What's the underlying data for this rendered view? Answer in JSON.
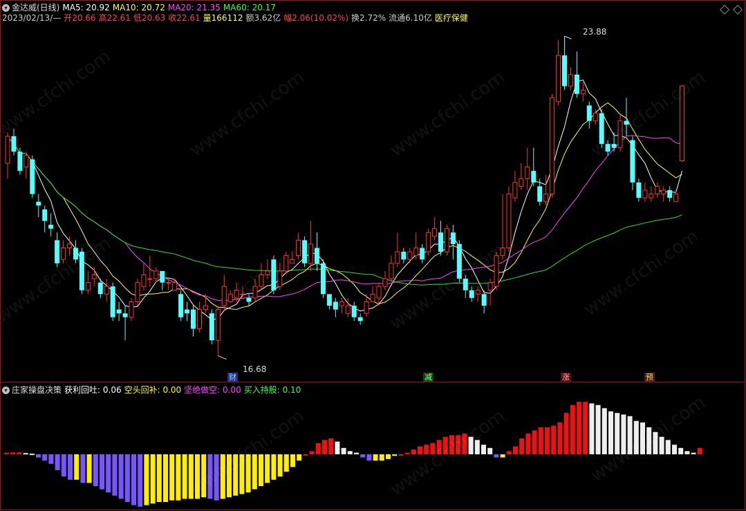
{
  "header": {
    "name": "金达威(日线)",
    "ma": [
      {
        "label": "MA5: 20.92",
        "color": "#ffffff"
      },
      {
        "label": "MA10: 20.72",
        "color": "#ffff55"
      },
      {
        "label": "MA20: 21.35",
        "color": "#ff44ff"
      },
      {
        "label": "MA60: 20.17",
        "color": "#44ff44"
      }
    ],
    "info": [
      {
        "label": "2023/02/13/—",
        "color": "#cccccc"
      },
      {
        "label": "开20.66",
        "color": "#ff4444"
      },
      {
        "label": "高22.61",
        "color": "#ff4444"
      },
      {
        "label": "低20.63",
        "color": "#ff4444"
      },
      {
        "label": "收22.61",
        "color": "#ff4444"
      },
      {
        "label": "量166112",
        "color": "#ffff55"
      },
      {
        "label": "额3.62亿",
        "color": "#cccccc"
      },
      {
        "label": "幅2.06(10.02%)",
        "color": "#ff4444"
      },
      {
        "label": "换2.72%",
        "color": "#cccccc"
      },
      {
        "label": "流通6.10亿",
        "color": "#cccccc"
      },
      {
        "label": "医疗保健",
        "color": "#ffff55"
      }
    ]
  },
  "price_chart": {
    "high_label": "23.88",
    "low_label": "16.68",
    "markers": [
      {
        "text": "财",
        "bg": "#333399",
        "color": "#88ccff"
      },
      {
        "text": "减",
        "bg": "#114411",
        "color": "#88ff88"
      },
      {
        "text": "涨",
        "bg": "#661111",
        "color": "#ffaaaa"
      },
      {
        "text": "预",
        "bg": "#553311",
        "color": "#ffcc88"
      }
    ],
    "watermark": "www.cfchi.com"
  },
  "indicator": {
    "name": "庄家操盘决策",
    "items": [
      {
        "label": "获利回吐: 0.06",
        "color": "#ffffff"
      },
      {
        "label": "空头回补: 0.00",
        "color": "#ffff00"
      },
      {
        "label": "坚绝做空: 0.00",
        "color": "#ff44ff"
      },
      {
        "label": "买入持股: 0.10",
        "color": "#44ff44"
      }
    ]
  },
  "chart_data": [
    {
      "type": "candlestick",
      "title": "金达威(日线)",
      "candles": [
        [
          20.6,
          21.3,
          21.4,
          20.2
        ],
        [
          21.3,
          20.9,
          21.5,
          20.8
        ],
        [
          20.9,
          20.4,
          21.0,
          20.3
        ],
        [
          20.5,
          20.8,
          20.9,
          20.2
        ],
        [
          20.7,
          19.8,
          20.8,
          19.7
        ],
        [
          19.6,
          19.5,
          19.8,
          19.2
        ],
        [
          19.4,
          19.1,
          19.5,
          18.8
        ],
        [
          19.0,
          18.9,
          19.3,
          18.7
        ],
        [
          18.6,
          18.0,
          18.8,
          17.9
        ],
        [
          18.1,
          18.4,
          18.6,
          18.0
        ],
        [
          18.4,
          18.5,
          18.7,
          18.2
        ],
        [
          18.4,
          18.1,
          18.6,
          18.0
        ],
        [
          18.3,
          17.3,
          18.4,
          17.2
        ],
        [
          17.3,
          17.5,
          17.8,
          17.2
        ],
        [
          17.6,
          17.7,
          17.9,
          17.4
        ],
        [
          17.5,
          17.2,
          17.6,
          17.1
        ],
        [
          17.2,
          17.4,
          17.6,
          17.0
        ],
        [
          17.4,
          16.6,
          17.5,
          16.5
        ],
        [
          16.8,
          16.7,
          17.0,
          16.5
        ],
        [
          16.7,
          16.6,
          16.9,
          16.0
        ],
        [
          16.6,
          17.0,
          17.1,
          16.5
        ],
        [
          17.0,
          17.5,
          17.6,
          16.9
        ],
        [
          17.4,
          17.7,
          18.0,
          17.3
        ],
        [
          17.6,
          17.6,
          18.2,
          17.4
        ],
        [
          17.6,
          17.8,
          17.9,
          17.5
        ],
        [
          17.8,
          17.5,
          17.8,
          17.3
        ],
        [
          17.5,
          17.5,
          17.6,
          17.3
        ],
        [
          17.3,
          17.5,
          17.6,
          17.3
        ],
        [
          17.2,
          16.6,
          17.3,
          16.5
        ],
        [
          16.8,
          16.7,
          17.0,
          16.5
        ],
        [
          16.8,
          16.3,
          16.9,
          16.1
        ],
        [
          16.3,
          16.8,
          17.0,
          16.2
        ],
        [
          16.8,
          16.9,
          17.2,
          16.7
        ],
        [
          16.7,
          16.0,
          16.8,
          15.9
        ],
        [
          16.0,
          16.8,
          16.9,
          15.6
        ],
        [
          16.9,
          17.4,
          17.7,
          16.8
        ],
        [
          17.0,
          17.2,
          17.3,
          17.0
        ],
        [
          17.1,
          17.3,
          17.5,
          17.0
        ],
        [
          17.2,
          17.2,
          17.4,
          17.1
        ],
        [
          17.1,
          17.0,
          17.2,
          16.9
        ],
        [
          17.1,
          17.4,
          17.6,
          17.0
        ],
        [
          17.4,
          17.7,
          18.0,
          17.3
        ],
        [
          17.7,
          17.8,
          18.1,
          17.6
        ],
        [
          18.1,
          17.3,
          18.2,
          17.2
        ],
        [
          17.4,
          17.8,
          18.0,
          17.3
        ],
        [
          17.8,
          18.2,
          18.3,
          17.7
        ],
        [
          18.0,
          18.1,
          18.3,
          18.0
        ],
        [
          18.2,
          18.6,
          18.8,
          18.1
        ],
        [
          18.6,
          18.0,
          18.7,
          17.9
        ],
        [
          18.0,
          18.5,
          19.1,
          17.8
        ],
        [
          18.4,
          18.0,
          18.8,
          17.8
        ],
        [
          18.0,
          17.2,
          18.1,
          17.1
        ],
        [
          17.2,
          16.9,
          17.2,
          16.8
        ],
        [
          17.0,
          16.8,
          17.1,
          16.6
        ],
        [
          16.9,
          17.0,
          17.1,
          16.7
        ],
        [
          16.7,
          16.9,
          17.1,
          16.6
        ],
        [
          16.9,
          16.6,
          17.0,
          16.5
        ],
        [
          16.6,
          16.5,
          16.7,
          16.4
        ],
        [
          16.7,
          17.0,
          17.2,
          16.6
        ],
        [
          17.0,
          17.2,
          17.4,
          17.0
        ],
        [
          17.1,
          17.4,
          17.5,
          16.9
        ],
        [
          17.4,
          17.6,
          17.8,
          17.3
        ],
        [
          17.6,
          18.0,
          18.2,
          17.5
        ],
        [
          18.0,
          18.3,
          18.8,
          17.9
        ],
        [
          18.3,
          18.1,
          18.4,
          18.0
        ],
        [
          18.1,
          18.3,
          18.4,
          18.0
        ],
        [
          18.2,
          18.4,
          18.8,
          18.1
        ],
        [
          18.4,
          18.1,
          18.5,
          18.0
        ],
        [
          18.3,
          18.8,
          18.9,
          18.2
        ],
        [
          18.7,
          18.9,
          19.2,
          18.6
        ],
        [
          18.8,
          18.3,
          19.1,
          18.2
        ],
        [
          18.3,
          18.9,
          19.0,
          18.2
        ],
        [
          18.8,
          18.5,
          19.0,
          18.1
        ],
        [
          18.5,
          17.6,
          18.6,
          17.5
        ],
        [
          17.6,
          17.3,
          17.7,
          17.1
        ],
        [
          17.3,
          17.1,
          17.4,
          17.0
        ],
        [
          17.2,
          17.3,
          17.4,
          17.0
        ],
        [
          17.2,
          16.9,
          17.3,
          16.7
        ],
        [
          17.3,
          17.5,
          17.6,
          16.9
        ],
        [
          17.4,
          18.2,
          18.3,
          17.3
        ],
        [
          18.2,
          18.4,
          19.8,
          18.1
        ],
        [
          18.4,
          19.8,
          20.0,
          18.3
        ],
        [
          19.7,
          20.1,
          20.4,
          19.6
        ],
        [
          20.0,
          20.2,
          20.6,
          19.9
        ],
        [
          20.2,
          20.5,
          21.0,
          19.9
        ],
        [
          20.4,
          20.1,
          21.0,
          20.0
        ],
        [
          20.0,
          19.6,
          20.2,
          19.5
        ],
        [
          19.6,
          19.8,
          20.3,
          19.5
        ],
        [
          19.8,
          22.3,
          22.4,
          19.7
        ],
        [
          22.2,
          23.4,
          23.8,
          22.1
        ],
        [
          23.4,
          22.6,
          23.9,
          22.5
        ],
        [
          22.6,
          22.9,
          23.1,
          22.5
        ],
        [
          22.9,
          22.4,
          23.5,
          22.3
        ],
        [
          22.4,
          22.5,
          22.7,
          22.2
        ],
        [
          22.1,
          21.7,
          22.2,
          21.5
        ],
        [
          21.7,
          21.9,
          22.0,
          21.6
        ],
        [
          21.9,
          21.1,
          22.0,
          21.0
        ],
        [
          21.1,
          20.9,
          21.2,
          20.8
        ],
        [
          21.1,
          21.0,
          21.4,
          20.9
        ],
        [
          21.0,
          21.7,
          21.9,
          20.9
        ],
        [
          21.7,
          21.6,
          22.3,
          21.3
        ],
        [
          21.2,
          20.1,
          21.3,
          19.9
        ],
        [
          20.1,
          19.7,
          20.2,
          19.6
        ],
        [
          19.7,
          19.9,
          20.1,
          19.6
        ],
        [
          19.7,
          19.8,
          20.0,
          19.6
        ],
        [
          19.8,
          20.0,
          20.1,
          19.7
        ],
        [
          19.8,
          19.9,
          20.0,
          19.6
        ],
        [
          19.9,
          19.7,
          20.0,
          19.6
        ],
        [
          19.6,
          19.8,
          19.9,
          19.6
        ],
        [
          20.66,
          22.61,
          22.61,
          20.63
        ]
      ]
    },
    {
      "type": "bar",
      "title": "庄家操盘决策",
      "values": [
        0.05,
        0.06,
        0.06,
        0.04,
        0.02,
        -0.1,
        -0.2,
        -0.3,
        -0.5,
        -0.7,
        -0.8,
        -0.8,
        -0.9,
        -0.9,
        -1.0,
        -1.1,
        -1.2,
        -1.3,
        -1.4,
        -1.5,
        -1.6,
        -1.65,
        -1.6,
        -1.55,
        -1.5,
        -1.5,
        -1.45,
        -1.45,
        -1.4,
        -1.4,
        -1.4,
        -1.35,
        -1.4,
        -1.45,
        -1.4,
        -1.35,
        -1.3,
        -1.25,
        -1.2,
        -1.1,
        -1.0,
        -0.9,
        -0.8,
        -0.7,
        -0.55,
        -0.4,
        -0.2,
        0.0,
        0.1,
        0.35,
        0.45,
        0.5,
        0.4,
        0.2,
        0.1,
        0.05,
        -0.1,
        -0.2,
        -0.2,
        -0.2,
        -0.15,
        -0.05,
        0.0,
        0.05,
        0.15,
        0.25,
        0.3,
        0.35,
        0.45,
        0.55,
        0.6,
        0.6,
        0.65,
        0.55,
        0.45,
        0.3,
        0.2,
        -0.1,
        -0.1,
        0.1,
        0.25,
        0.5,
        0.65,
        0.75,
        0.85,
        0.85,
        0.9,
        1.0,
        1.3,
        1.55,
        1.65,
        1.65,
        1.6,
        1.55,
        1.45,
        1.35,
        1.3,
        1.25,
        1.2,
        1.05,
        1.0,
        0.85,
        0.7,
        0.55,
        0.45,
        0.3,
        0.2,
        0.1,
        0.05,
        0.2
      ],
      "colors": "red=positive rising, white=positive falling, purple=negative, yellow=negative recovering"
    }
  ]
}
